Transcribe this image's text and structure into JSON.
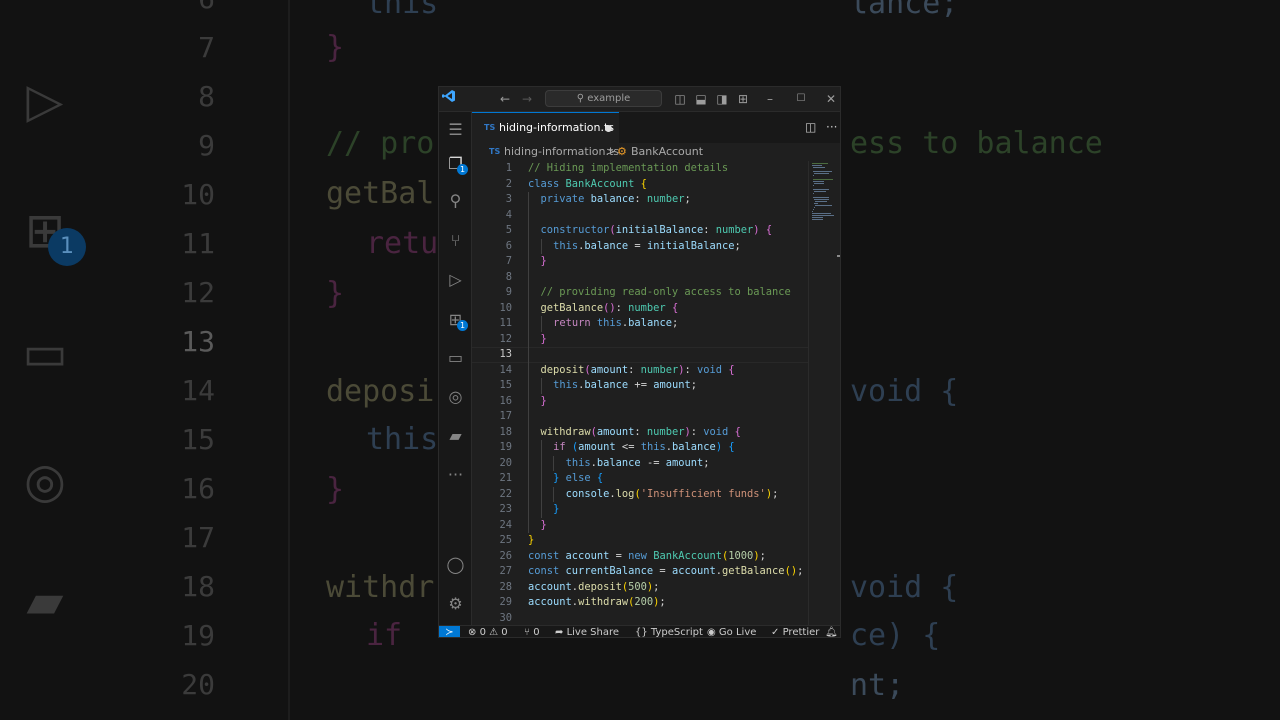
{
  "background": {
    "line_numbers": [
      "6",
      "7",
      "8",
      "9",
      "10",
      "11",
      "12",
      "13",
      "14",
      "15",
      "16",
      "17",
      "18",
      "19",
      "20"
    ],
    "current_line_number": "13",
    "badge": "1"
  },
  "titlebar": {
    "search_placeholder": "example",
    "back_icon": "arrow-left-icon",
    "forward_icon": "arrow-right-icon"
  },
  "activity_bar": {
    "explorer_badge": "1",
    "extensions_badge": "1",
    "more_label": "···"
  },
  "tab": {
    "lang_badge": "TS",
    "filename": "hiding-information.ts"
  },
  "breadcrumb": {
    "file_badge": "TS",
    "file": "hiding-information.ts",
    "separator": ">",
    "symbol": "BankAccount"
  },
  "editor": {
    "current_line": 13,
    "lines": [
      {
        "n": "1",
        "code": "// Hiding implementation details"
      },
      {
        "n": "2",
        "code": "class BankAccount {"
      },
      {
        "n": "3",
        "code": "  private balance: number;"
      },
      {
        "n": "4",
        "code": ""
      },
      {
        "n": "5",
        "code": "  constructor(initialBalance: number) {"
      },
      {
        "n": "6",
        "code": "    this.balance = initialBalance;"
      },
      {
        "n": "7",
        "code": "  }"
      },
      {
        "n": "8",
        "code": ""
      },
      {
        "n": "9",
        "code": "  // providing read-only access to balance"
      },
      {
        "n": "10",
        "code": "  getBalance(): number {"
      },
      {
        "n": "11",
        "code": "    return this.balance;"
      },
      {
        "n": "12",
        "code": "  }"
      },
      {
        "n": "13",
        "code": ""
      },
      {
        "n": "14",
        "code": "  deposit(amount: number): void {"
      },
      {
        "n": "15",
        "code": "    this.balance += amount;"
      },
      {
        "n": "16",
        "code": "  }"
      },
      {
        "n": "17",
        "code": ""
      },
      {
        "n": "18",
        "code": "  withdraw(amount: number): void {"
      },
      {
        "n": "19",
        "code": "    if (amount <= this.balance) {"
      },
      {
        "n": "20",
        "code": "      this.balance -= amount;"
      },
      {
        "n": "21",
        "code": "    } else {"
      },
      {
        "n": "22",
        "code": "      console.log('Insufficient funds');"
      },
      {
        "n": "23",
        "code": "    }"
      },
      {
        "n": "24",
        "code": "  }"
      },
      {
        "n": "25",
        "code": "}"
      },
      {
        "n": "26",
        "code": "const account = new BankAccount(1000);"
      },
      {
        "n": "27",
        "code": "const currentBalance = account.getBalance();"
      },
      {
        "n": "28",
        "code": "account.deposit(500);"
      },
      {
        "n": "29",
        "code": "account.withdraw(200);"
      },
      {
        "n": "30",
        "code": ""
      }
    ]
  },
  "statusbar": {
    "errors": "0",
    "warnings": "0",
    "ports": "0",
    "live_share": "Live Share",
    "language": "TypeScript",
    "go_live": "Go Live",
    "prettier": "Prettier"
  }
}
